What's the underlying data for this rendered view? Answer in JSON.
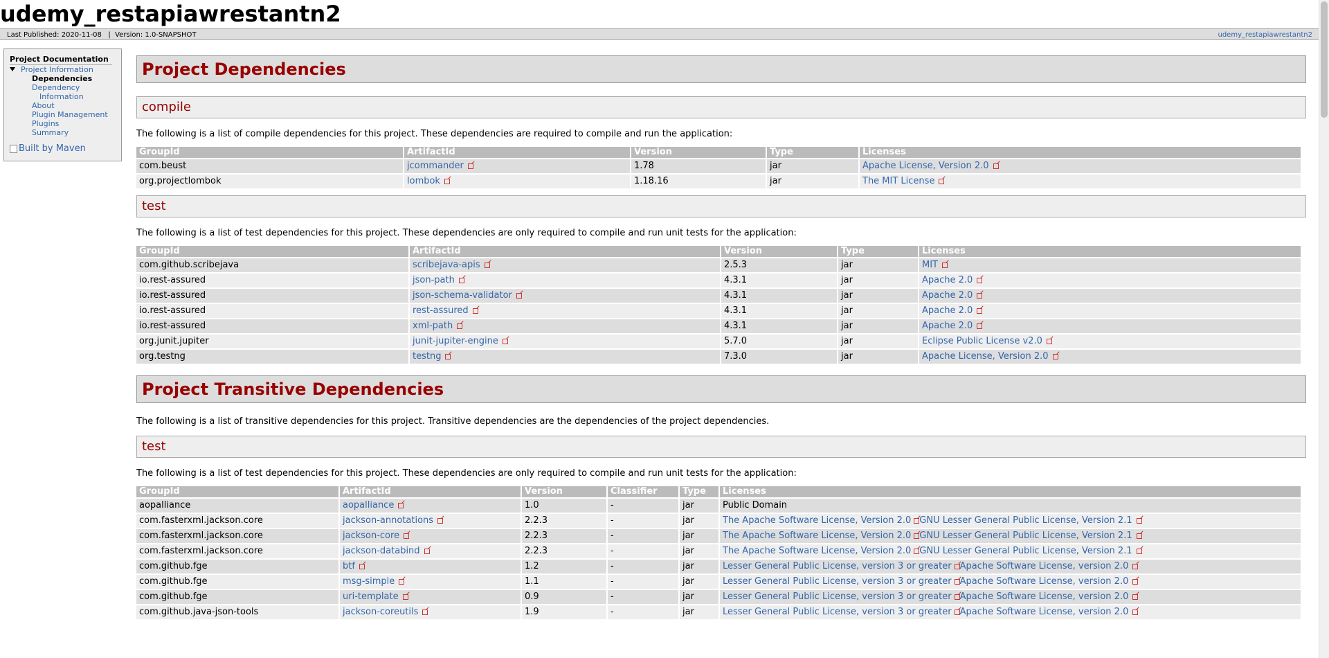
{
  "banner": {
    "title": "udemy_restapiawrestantn2"
  },
  "breadcrumbs": {
    "published": "Last Published: 2020-11-08",
    "separator": " | ",
    "version": "Version: 1.0-SNAPSHOT",
    "right_link": "udemy_restapiawrestantn2"
  },
  "nav": {
    "heading": "Project Documentation",
    "project_info": "Project Information",
    "items": [
      {
        "label": "Dependencies",
        "selected": true
      },
      {
        "label": "Dependency",
        "label2": "Information"
      },
      {
        "label": "About"
      },
      {
        "label": "Plugin Management"
      },
      {
        "label": "Plugins"
      },
      {
        "label": "Summary"
      }
    ],
    "maven": "Built by Maven"
  },
  "colors": {
    "heading": "#990000",
    "link": "#3366aa",
    "table_header": "#bbbbbb"
  },
  "main": {
    "title": "Project Dependencies",
    "compile": {
      "title": "compile",
      "desc": "The following is a list of compile dependencies for this project. These dependencies are required to compile and run the application:",
      "headers": [
        "GroupId",
        "ArtifactId",
        "Version",
        "Type",
        "Licenses"
      ],
      "rows": [
        {
          "group": "com.beust",
          "artifact": "jcommander",
          "version": "1.78",
          "type": "jar",
          "license": "Apache License, Version 2.0"
        },
        {
          "group": "org.projectlombok",
          "artifact": "lombok",
          "version": "1.18.16",
          "type": "jar",
          "license": "The MIT License"
        }
      ]
    },
    "test": {
      "title": "test",
      "desc": "The following is a list of test dependencies for this project. These dependencies are only required to compile and run unit tests for the application:",
      "headers": [
        "GroupId",
        "ArtifactId",
        "Version",
        "Type",
        "Licenses"
      ],
      "rows": [
        {
          "group": "com.github.scribejava",
          "artifact": "scribejava-apis",
          "version": "2.5.3",
          "type": "jar",
          "license": "MIT"
        },
        {
          "group": "io.rest-assured",
          "artifact": "json-path",
          "version": "4.3.1",
          "type": "jar",
          "license": "Apache 2.0"
        },
        {
          "group": "io.rest-assured",
          "artifact": "json-schema-validator",
          "version": "4.3.1",
          "type": "jar",
          "license": "Apache 2.0"
        },
        {
          "group": "io.rest-assured",
          "artifact": "rest-assured",
          "version": "4.3.1",
          "type": "jar",
          "license": "Apache 2.0"
        },
        {
          "group": "io.rest-assured",
          "artifact": "xml-path",
          "version": "4.3.1",
          "type": "jar",
          "license": "Apache 2.0"
        },
        {
          "group": "org.junit.jupiter",
          "artifact": "junit-jupiter-engine",
          "version": "5.7.0",
          "type": "jar",
          "license": "Eclipse Public License v2.0"
        },
        {
          "group": "org.testng",
          "artifact": "testng",
          "version": "7.3.0",
          "type": "jar",
          "license": "Apache License, Version 2.0"
        }
      ]
    }
  },
  "transitive": {
    "title": "Project Transitive Dependencies",
    "desc": "The following is a list of transitive dependencies for this project. Transitive dependencies are the dependencies of the project dependencies.",
    "test": {
      "title": "test",
      "desc": "The following is a list of test dependencies for this project. These dependencies are only required to compile and run unit tests for the application:",
      "headers": [
        "GroupId",
        "ArtifactId",
        "Version",
        "Classifier",
        "Type",
        "Licenses"
      ],
      "rows": [
        {
          "group": "aopalliance",
          "artifact": "aopalliance",
          "version": "1.0",
          "classifier": "-",
          "type": "jar",
          "license1": "Public Domain",
          "license1_link": false,
          "license2": ""
        },
        {
          "group": "com.fasterxml.jackson.core",
          "artifact": "jackson-annotations",
          "version": "2.2.3",
          "classifier": "-",
          "type": "jar",
          "license1": "The Apache Software License, Version 2.0",
          "license1_link": true,
          "license2": "GNU Lesser General Public License, Version 2.1"
        },
        {
          "group": "com.fasterxml.jackson.core",
          "artifact": "jackson-core",
          "version": "2.2.3",
          "classifier": "-",
          "type": "jar",
          "license1": "The Apache Software License, Version 2.0",
          "license1_link": true,
          "license2": "GNU Lesser General Public License, Version 2.1"
        },
        {
          "group": "com.fasterxml.jackson.core",
          "artifact": "jackson-databind",
          "version": "2.2.3",
          "classifier": "-",
          "type": "jar",
          "license1": "The Apache Software License, Version 2.0",
          "license1_link": true,
          "license2": "GNU Lesser General Public License, Version 2.1"
        },
        {
          "group": "com.github.fge",
          "artifact": "btf",
          "version": "1.2",
          "classifier": "-",
          "type": "jar",
          "license1": "Lesser General Public License, version 3 or greater",
          "license1_link": true,
          "license2": "Apache Software License, version 2.0"
        },
        {
          "group": "com.github.fge",
          "artifact": "msg-simple",
          "version": "1.1",
          "classifier": "-",
          "type": "jar",
          "license1": "Lesser General Public License, version 3 or greater",
          "license1_link": true,
          "license2": "Apache Software License, version 2.0"
        },
        {
          "group": "com.github.fge",
          "artifact": "uri-template",
          "version": "0.9",
          "classifier": "-",
          "type": "jar",
          "license1": "Lesser General Public License, version 3 or greater",
          "license1_link": true,
          "license2": "Apache Software License, version 2.0"
        },
        {
          "group": "com.github.java-json-tools",
          "artifact": "jackson-coreutils",
          "version": "1.9",
          "classifier": "-",
          "type": "jar",
          "license1": "Lesser General Public License, version 3 or greater",
          "license1_link": true,
          "license2": "Apache Software License, version 2.0"
        }
      ]
    }
  }
}
